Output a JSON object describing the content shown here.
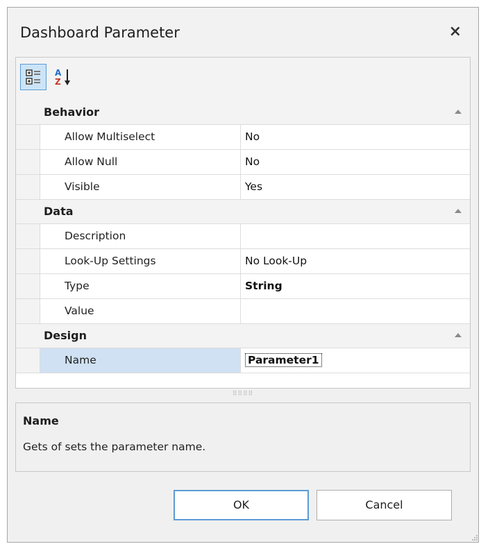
{
  "dialog": {
    "title": "Dashboard Parameter",
    "close_glyph": "×"
  },
  "toolbar": {
    "categorized_icon": "categorized-icon",
    "alphabetical_icon": "sort-az-icon"
  },
  "categories": [
    {
      "name": "Behavior",
      "properties": [
        {
          "name": "Allow Multiselect",
          "value": "No"
        },
        {
          "name": "Allow Null",
          "value": "No"
        },
        {
          "name": "Visible",
          "value": "Yes"
        }
      ]
    },
    {
      "name": "Data",
      "properties": [
        {
          "name": "Description",
          "value": ""
        },
        {
          "name": "Look-Up Settings",
          "value": "No Look-Up"
        },
        {
          "name": "Type",
          "value": "String"
        },
        {
          "name": "Value",
          "value": ""
        }
      ]
    },
    {
      "name": "Design",
      "properties": [
        {
          "name": "Name",
          "value": "Parameter1"
        }
      ]
    }
  ],
  "description": {
    "title": "Name",
    "text": "Gets of sets the parameter name."
  },
  "buttons": {
    "ok": "OK",
    "cancel": "Cancel"
  },
  "colors": {
    "selection": "#cfe1f3",
    "accent": "#5b9bd5"
  }
}
